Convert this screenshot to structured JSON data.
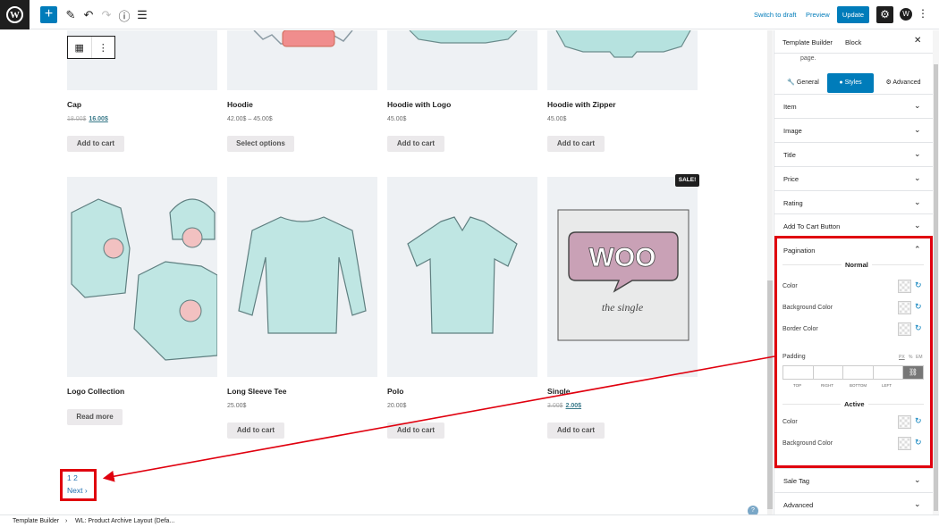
{
  "header": {
    "switch_to_draft": "Switch to draft",
    "preview": "Preview",
    "update": "Update"
  },
  "products": [
    {
      "title": "Cap",
      "price_old": "18.00$",
      "price": "16.00$",
      "button": "Add to cart"
    },
    {
      "title": "Hoodie",
      "price": "42.00$ – 45.00$",
      "button": "Select options"
    },
    {
      "title": "Hoodie with Logo",
      "price": "45.00$",
      "button": "Add to cart"
    },
    {
      "title": "Hoodie with Zipper",
      "price": "45.00$",
      "button": "Add to cart"
    },
    {
      "title": "Logo Collection",
      "price": "",
      "button": "Read more"
    },
    {
      "title": "Long Sleeve Tee",
      "price": "25.00$",
      "button": "Add to cart"
    },
    {
      "title": "Polo",
      "price": "20.00$",
      "button": "Add to cart"
    },
    {
      "title": "Single",
      "price_old": "3.00$",
      "price": "2.00$",
      "button": "Add to cart",
      "badge": "SALE!"
    }
  ],
  "woo_logo_text": "WOO",
  "woo_logo_sub": "the single",
  "pagination": {
    "pages": "1 2",
    "next": "Next ›"
  },
  "sidebar": {
    "tabs": {
      "template_builder": "Template Builder",
      "block": "Block"
    },
    "desc": "page.",
    "style_tabs": {
      "general": "General",
      "styles": "Styles",
      "advanced": "Advanced"
    },
    "accordions_top": [
      "Item",
      "Image",
      "Title",
      "Price",
      "Rating",
      "Add To Cart Button"
    ],
    "pagination": {
      "title": "Pagination",
      "normal": "Normal",
      "color": "Color",
      "background_color": "Background Color",
      "border_color": "Border Color",
      "padding": "Padding",
      "units": [
        "PX",
        "%",
        "EM"
      ],
      "pad_labels": [
        "TOP",
        "RIGHT",
        "BOTTOM",
        "LEFT"
      ],
      "active": "Active",
      "active_color": "Color",
      "active_background": "Background Color"
    },
    "accordions_bottom": [
      "Sale Tag",
      "Advanced"
    ]
  },
  "footer": {
    "crumb1": "Template Builder",
    "crumb2": "WL: Product Archive Layout (Defa..."
  },
  "colors": {
    "accent": "#007cba",
    "highlight": "#e0000e",
    "product_bg": "#eef1f4"
  }
}
